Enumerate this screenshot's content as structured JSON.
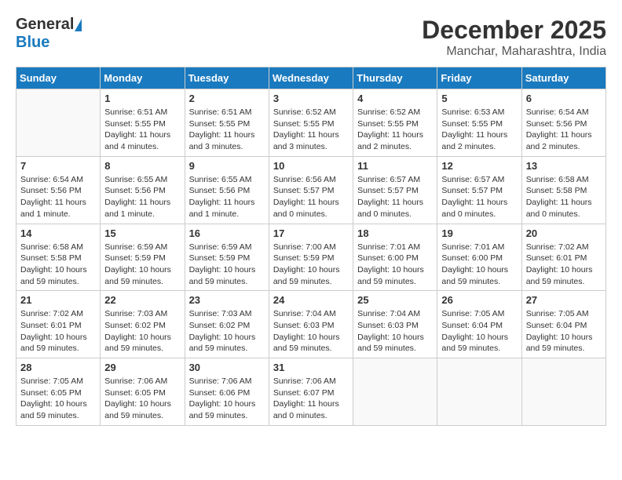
{
  "header": {
    "logo_general": "General",
    "logo_blue": "Blue",
    "month_title": "December 2025",
    "location": "Manchar, Maharashtra, India"
  },
  "days_of_week": [
    "Sunday",
    "Monday",
    "Tuesday",
    "Wednesday",
    "Thursday",
    "Friday",
    "Saturday"
  ],
  "weeks": [
    [
      {
        "day": "",
        "sunrise": "",
        "sunset": "",
        "daylight": ""
      },
      {
        "day": "1",
        "sunrise": "Sunrise: 6:51 AM",
        "sunset": "Sunset: 5:55 PM",
        "daylight": "Daylight: 11 hours and 4 minutes."
      },
      {
        "day": "2",
        "sunrise": "Sunrise: 6:51 AM",
        "sunset": "Sunset: 5:55 PM",
        "daylight": "Daylight: 11 hours and 3 minutes."
      },
      {
        "day": "3",
        "sunrise": "Sunrise: 6:52 AM",
        "sunset": "Sunset: 5:55 PM",
        "daylight": "Daylight: 11 hours and 3 minutes."
      },
      {
        "day": "4",
        "sunrise": "Sunrise: 6:52 AM",
        "sunset": "Sunset: 5:55 PM",
        "daylight": "Daylight: 11 hours and 2 minutes."
      },
      {
        "day": "5",
        "sunrise": "Sunrise: 6:53 AM",
        "sunset": "Sunset: 5:55 PM",
        "daylight": "Daylight: 11 hours and 2 minutes."
      },
      {
        "day": "6",
        "sunrise": "Sunrise: 6:54 AM",
        "sunset": "Sunset: 5:56 PM",
        "daylight": "Daylight: 11 hours and 2 minutes."
      }
    ],
    [
      {
        "day": "7",
        "sunrise": "Sunrise: 6:54 AM",
        "sunset": "Sunset: 5:56 PM",
        "daylight": "Daylight: 11 hours and 1 minute."
      },
      {
        "day": "8",
        "sunrise": "Sunrise: 6:55 AM",
        "sunset": "Sunset: 5:56 PM",
        "daylight": "Daylight: 11 hours and 1 minute."
      },
      {
        "day": "9",
        "sunrise": "Sunrise: 6:55 AM",
        "sunset": "Sunset: 5:56 PM",
        "daylight": "Daylight: 11 hours and 1 minute."
      },
      {
        "day": "10",
        "sunrise": "Sunrise: 6:56 AM",
        "sunset": "Sunset: 5:57 PM",
        "daylight": "Daylight: 11 hours and 0 minutes."
      },
      {
        "day": "11",
        "sunrise": "Sunrise: 6:57 AM",
        "sunset": "Sunset: 5:57 PM",
        "daylight": "Daylight: 11 hours and 0 minutes."
      },
      {
        "day": "12",
        "sunrise": "Sunrise: 6:57 AM",
        "sunset": "Sunset: 5:57 PM",
        "daylight": "Daylight: 11 hours and 0 minutes."
      },
      {
        "day": "13",
        "sunrise": "Sunrise: 6:58 AM",
        "sunset": "Sunset: 5:58 PM",
        "daylight": "Daylight: 11 hours and 0 minutes."
      }
    ],
    [
      {
        "day": "14",
        "sunrise": "Sunrise: 6:58 AM",
        "sunset": "Sunset: 5:58 PM",
        "daylight": "Daylight: 10 hours and 59 minutes."
      },
      {
        "day": "15",
        "sunrise": "Sunrise: 6:59 AM",
        "sunset": "Sunset: 5:59 PM",
        "daylight": "Daylight: 10 hours and 59 minutes."
      },
      {
        "day": "16",
        "sunrise": "Sunrise: 6:59 AM",
        "sunset": "Sunset: 5:59 PM",
        "daylight": "Daylight: 10 hours and 59 minutes."
      },
      {
        "day": "17",
        "sunrise": "Sunrise: 7:00 AM",
        "sunset": "Sunset: 5:59 PM",
        "daylight": "Daylight: 10 hours and 59 minutes."
      },
      {
        "day": "18",
        "sunrise": "Sunrise: 7:01 AM",
        "sunset": "Sunset: 6:00 PM",
        "daylight": "Daylight: 10 hours and 59 minutes."
      },
      {
        "day": "19",
        "sunrise": "Sunrise: 7:01 AM",
        "sunset": "Sunset: 6:00 PM",
        "daylight": "Daylight: 10 hours and 59 minutes."
      },
      {
        "day": "20",
        "sunrise": "Sunrise: 7:02 AM",
        "sunset": "Sunset: 6:01 PM",
        "daylight": "Daylight: 10 hours and 59 minutes."
      }
    ],
    [
      {
        "day": "21",
        "sunrise": "Sunrise: 7:02 AM",
        "sunset": "Sunset: 6:01 PM",
        "daylight": "Daylight: 10 hours and 59 minutes."
      },
      {
        "day": "22",
        "sunrise": "Sunrise: 7:03 AM",
        "sunset": "Sunset: 6:02 PM",
        "daylight": "Daylight: 10 hours and 59 minutes."
      },
      {
        "day": "23",
        "sunrise": "Sunrise: 7:03 AM",
        "sunset": "Sunset: 6:02 PM",
        "daylight": "Daylight: 10 hours and 59 minutes."
      },
      {
        "day": "24",
        "sunrise": "Sunrise: 7:04 AM",
        "sunset": "Sunset: 6:03 PM",
        "daylight": "Daylight: 10 hours and 59 minutes."
      },
      {
        "day": "25",
        "sunrise": "Sunrise: 7:04 AM",
        "sunset": "Sunset: 6:03 PM",
        "daylight": "Daylight: 10 hours and 59 minutes."
      },
      {
        "day": "26",
        "sunrise": "Sunrise: 7:05 AM",
        "sunset": "Sunset: 6:04 PM",
        "daylight": "Daylight: 10 hours and 59 minutes."
      },
      {
        "day": "27",
        "sunrise": "Sunrise: 7:05 AM",
        "sunset": "Sunset: 6:04 PM",
        "daylight": "Daylight: 10 hours and 59 minutes."
      }
    ],
    [
      {
        "day": "28",
        "sunrise": "Sunrise: 7:05 AM",
        "sunset": "Sunset: 6:05 PM",
        "daylight": "Daylight: 10 hours and 59 minutes."
      },
      {
        "day": "29",
        "sunrise": "Sunrise: 7:06 AM",
        "sunset": "Sunset: 6:05 PM",
        "daylight": "Daylight: 10 hours and 59 minutes."
      },
      {
        "day": "30",
        "sunrise": "Sunrise: 7:06 AM",
        "sunset": "Sunset: 6:06 PM",
        "daylight": "Daylight: 10 hours and 59 minutes."
      },
      {
        "day": "31",
        "sunrise": "Sunrise: 7:06 AM",
        "sunset": "Sunset: 6:07 PM",
        "daylight": "Daylight: 11 hours and 0 minutes."
      },
      {
        "day": "",
        "sunrise": "",
        "sunset": "",
        "daylight": ""
      },
      {
        "day": "",
        "sunrise": "",
        "sunset": "",
        "daylight": ""
      },
      {
        "day": "",
        "sunrise": "",
        "sunset": "",
        "daylight": ""
      }
    ]
  ]
}
